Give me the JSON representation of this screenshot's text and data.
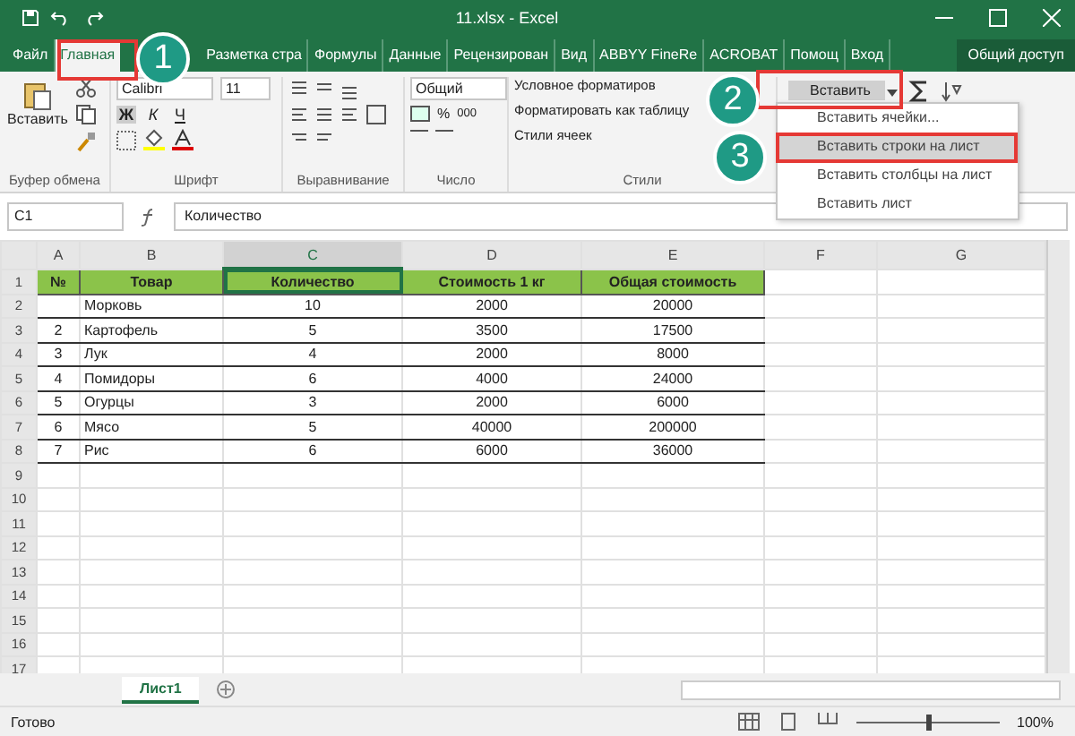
{
  "window": {
    "title": "11.xlsx - Excel",
    "account_tab": "Вход",
    "share": "Общий доступ"
  },
  "tabs": [
    {
      "label": "Файл",
      "selected": false
    },
    {
      "label": "Главная",
      "selected": true
    },
    {
      "label": "Разметка стра",
      "selected": false
    },
    {
      "label": "Формулы",
      "selected": false
    },
    {
      "label": "Данные",
      "selected": false
    },
    {
      "label": "Рецензирован",
      "selected": false
    },
    {
      "label": "Вид",
      "selected": false
    },
    {
      "label": "ABBYY FineRe",
      "selected": false
    },
    {
      "label": "ACROBAT",
      "selected": false
    }
  ],
  "help": "Помощ",
  "ribbon": {
    "paste": "Вставить",
    "font_name": "Calibri",
    "font_size": "11",
    "bold": "Ж",
    "italic": "К",
    "underline": "Ч",
    "number_format": "Общий",
    "percent": "%",
    "thousands": "000",
    "styles": [
      "Условное форматиров",
      "Форматировать как таблицу",
      "Стили ячеек"
    ],
    "insert": "Вставить",
    "groups": [
      "Буфер обмена",
      "Шрифт",
      "Выравнивание",
      "Число",
      "Стили"
    ]
  },
  "menu": [
    {
      "label": "Вставить ячейки...",
      "selected": false
    },
    {
      "label": "Вставить строки на лист",
      "selected": true
    },
    {
      "label": "Вставить столбцы на лист",
      "selected": false
    },
    {
      "label": "Вставить лист",
      "selected": false
    }
  ],
  "formula_bar": {
    "name_box": "C1",
    "value": "Количество"
  },
  "columns": [
    {
      "label": "A",
      "selected": false
    },
    {
      "label": "B",
      "selected": false
    },
    {
      "label": "C",
      "selected": true
    },
    {
      "label": "D",
      "selected": false
    },
    {
      "label": "E",
      "selected": false
    },
    {
      "label": "F",
      "selected": false
    },
    {
      "label": "G",
      "selected": false
    }
  ],
  "table": {
    "header": [
      "№",
      "Товар",
      "Количество",
      "Стоимость 1 кг",
      "Общая стоимость"
    ],
    "rows": [
      {
        "item": "Морковь",
        "qty": "10",
        "price": "2000",
        "total": "20000"
      },
      {
        "no": "2",
        "item": "Картофель",
        "qty": "5",
        "price": "3500",
        "total": "17500"
      },
      {
        "no": "3",
        "item": "Лук",
        "qty": "4",
        "price": "2000",
        "total": "8000"
      },
      {
        "no": "4",
        "item": "Помидоры",
        "qty": "6",
        "price": "4000",
        "total": "24000"
      },
      {
        "no": "5",
        "item": "Огурцы",
        "qty": "3",
        "price": "2000",
        "total": "6000"
      },
      {
        "no": "6",
        "item": "Мясо",
        "qty": "5",
        "price": "40000",
        "total": "200000"
      },
      {
        "no": "7",
        "item": "Рис",
        "qty": "6",
        "price": "6000",
        "total": "36000"
      }
    ]
  },
  "row_numbers": [
    "1",
    "2",
    "3",
    "4",
    "5",
    "6",
    "7",
    "8",
    "9",
    "10",
    "11",
    "12",
    "13",
    "14",
    "15",
    "16",
    "17"
  ],
  "sheet_tab": "Лист1",
  "status_bar": {
    "status": "Готово",
    "zoom": "100%",
    "zoom_slider": {
      "level": 0.5
    }
  },
  "callouts": [
    {
      "label": "1"
    },
    {
      "label": "2"
    },
    {
      "label": "3"
    }
  ]
}
